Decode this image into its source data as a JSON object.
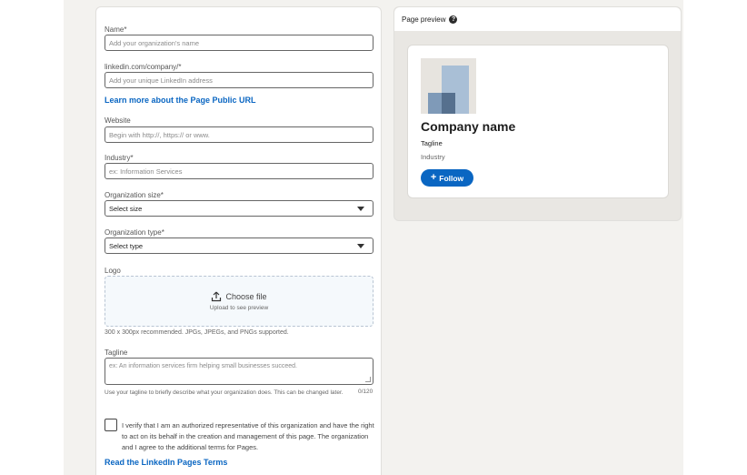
{
  "form": {
    "name_label": "Name*",
    "name_placeholder": "Add your organization's name",
    "url_label": "linkedin.com/company/*",
    "url_placeholder": "Add your unique LinkedIn address",
    "url_learn_more": "Learn more about the Page Public URL",
    "website_label": "Website",
    "website_placeholder": "Begin with http://, https:// or www.",
    "industry_label": "Industry*",
    "industry_placeholder": "ex: Information Services",
    "size_label": "Organization size*",
    "size_value": "Select size",
    "type_label": "Organization type*",
    "type_value": "Select type",
    "logo_label": "Logo",
    "logo_choose": "Choose file",
    "logo_sub": "Upload to see preview",
    "logo_helper": "300 x 300px recommended. JPGs, JPEGs, and PNGs supported.",
    "tagline_label": "Tagline",
    "tagline_placeholder": "ex: An information services firm helping small businesses succeed.",
    "tagline_helper": "Use your tagline to briefly describe what your organization does. This can be changed later.",
    "tagline_counter": "0/120",
    "verify_text": "I verify that I am an authorized representative of this organization and have the right to act on its behalf in the creation and management of this page. The organization and I agree to the additional terms for Pages.",
    "terms_link": "Read the LinkedIn Pages Terms"
  },
  "preview": {
    "header": "Page preview",
    "help_icon": "question-circle-icon",
    "company_name": "Company name",
    "tagline": "Tagline",
    "industry": "Industry",
    "follow_label": "Follow"
  },
  "colors": {
    "accent": "#0a66c2",
    "background": "#f3f2ef"
  }
}
